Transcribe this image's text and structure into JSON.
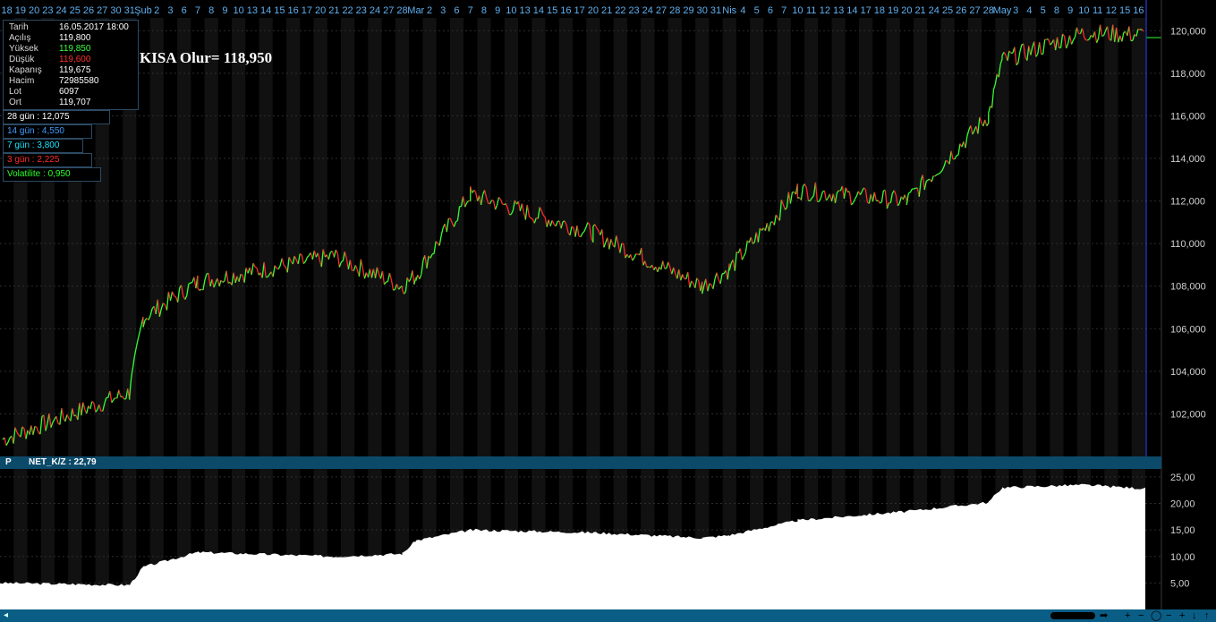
{
  "date_axis": {
    "labels": [
      "18",
      "19",
      "20",
      "23",
      "24",
      "25",
      "26",
      "27",
      "30",
      "31",
      "Şub",
      "2",
      "3",
      "6",
      "7",
      "8",
      "9",
      "10",
      "13",
      "14",
      "15",
      "16",
      "17",
      "20",
      "21",
      "22",
      "23",
      "24",
      "27",
      "28",
      "Mar",
      "2",
      "3",
      "6",
      "7",
      "8",
      "9",
      "10",
      "13",
      "14",
      "15",
      "16",
      "17",
      "20",
      "21",
      "22",
      "23",
      "24",
      "27",
      "28",
      "29",
      "30",
      "31",
      "Nis",
      "4",
      "5",
      "6",
      "7",
      "10",
      "11",
      "12",
      "13",
      "14",
      "17",
      "18",
      "19",
      "20",
      "21",
      "24",
      "25",
      "26",
      "27",
      "28",
      "May",
      "3",
      "4",
      "5",
      "8",
      "9",
      "10",
      "11",
      "12",
      "15",
      "16"
    ]
  },
  "price_axis": {
    "labels": [
      "102,000",
      "104,000",
      "106,000",
      "108,000",
      "110,000",
      "112,000",
      "114,000",
      "116,000",
      "118,000",
      "120,000"
    ]
  },
  "lower_axis": {
    "labels": [
      "5,00",
      "10,00",
      "15,00",
      "20,00",
      "25,00"
    ]
  },
  "info_box": {
    "rows": [
      {
        "label": "Tarih",
        "value": "16.05.2017 18:00",
        "color": "#ffffff"
      },
      {
        "label": "Açılış",
        "value": "119,800",
        "color": "#ffffff"
      },
      {
        "label": "Yüksek",
        "value": "119,850",
        "color": "#3cff3c"
      },
      {
        "label": "Düşük",
        "value": "119,600",
        "color": "#ff3030"
      },
      {
        "label": "Kapanış",
        "value": "119,675",
        "color": "#ffffff"
      },
      {
        "label": "Hacim",
        "value": "72985580",
        "color": "#ffffff"
      },
      {
        "label": "Lot",
        "value": "6097",
        "color": "#ffffff"
      },
      {
        "label": "Ort",
        "value": "119,707",
        "color": "#ffffff"
      }
    ]
  },
  "indicators": [
    {
      "text": "28 gün : 12,075",
      "color": "#ffffff"
    },
    {
      "text": "14 gün : 4,550",
      "color": "#3d9bff"
    },
    {
      "text": "7 gün : 3,800",
      "color": "#19e6ff"
    },
    {
      "text": "3 gün : 2,225",
      "color": "#ff2a2a"
    },
    {
      "text": "Volatilite : 0,950",
      "color": "#2aff2a"
    }
  ],
  "annotation": "KISA Olur= 118,950",
  "lower_panel": {
    "letter": "P",
    "title": "NET_K/Z : 22,79"
  },
  "colors": {
    "up": "#33ff33",
    "down": "#ff2a2a",
    "neutral": "#ffff33",
    "grid": "#2e2e2e",
    "band": "#111111",
    "panel_bar": "#0c4a6a"
  },
  "chart_data": [
    {
      "type": "line",
      "x": [
        "18",
        "31",
        "Şub",
        "7",
        "21",
        "28",
        "Mar",
        "7",
        "20",
        "30",
        "Nis",
        "10",
        "20",
        "28",
        "May",
        "10",
        "16"
      ],
      "y": [
        100.8,
        103.0,
        106.5,
        108.2,
        109.4,
        108.0,
        108.5,
        112.3,
        110.5,
        108.0,
        108.8,
        112.5,
        112.0,
        116.0,
        118.6,
        119.9,
        119.8
      ],
      "ylim": [
        100.0,
        120.6
      ],
      "last_value": 119.675
    },
    {
      "type": "area",
      "x": [
        "18",
        "31",
        "Şub",
        "7",
        "21",
        "28",
        "Mar",
        "7",
        "20",
        "30",
        "Nis",
        "10",
        "20",
        "28",
        "May",
        "10",
        "16"
      ],
      "y": [
        5.0,
        4.6,
        8.0,
        10.8,
        10.0,
        10.5,
        13.0,
        15.0,
        14.5,
        13.5,
        14.0,
        16.8,
        18.5,
        20.2,
        23.0,
        23.5,
        22.79
      ],
      "ylim": [
        0,
        26.5
      ]
    }
  ]
}
